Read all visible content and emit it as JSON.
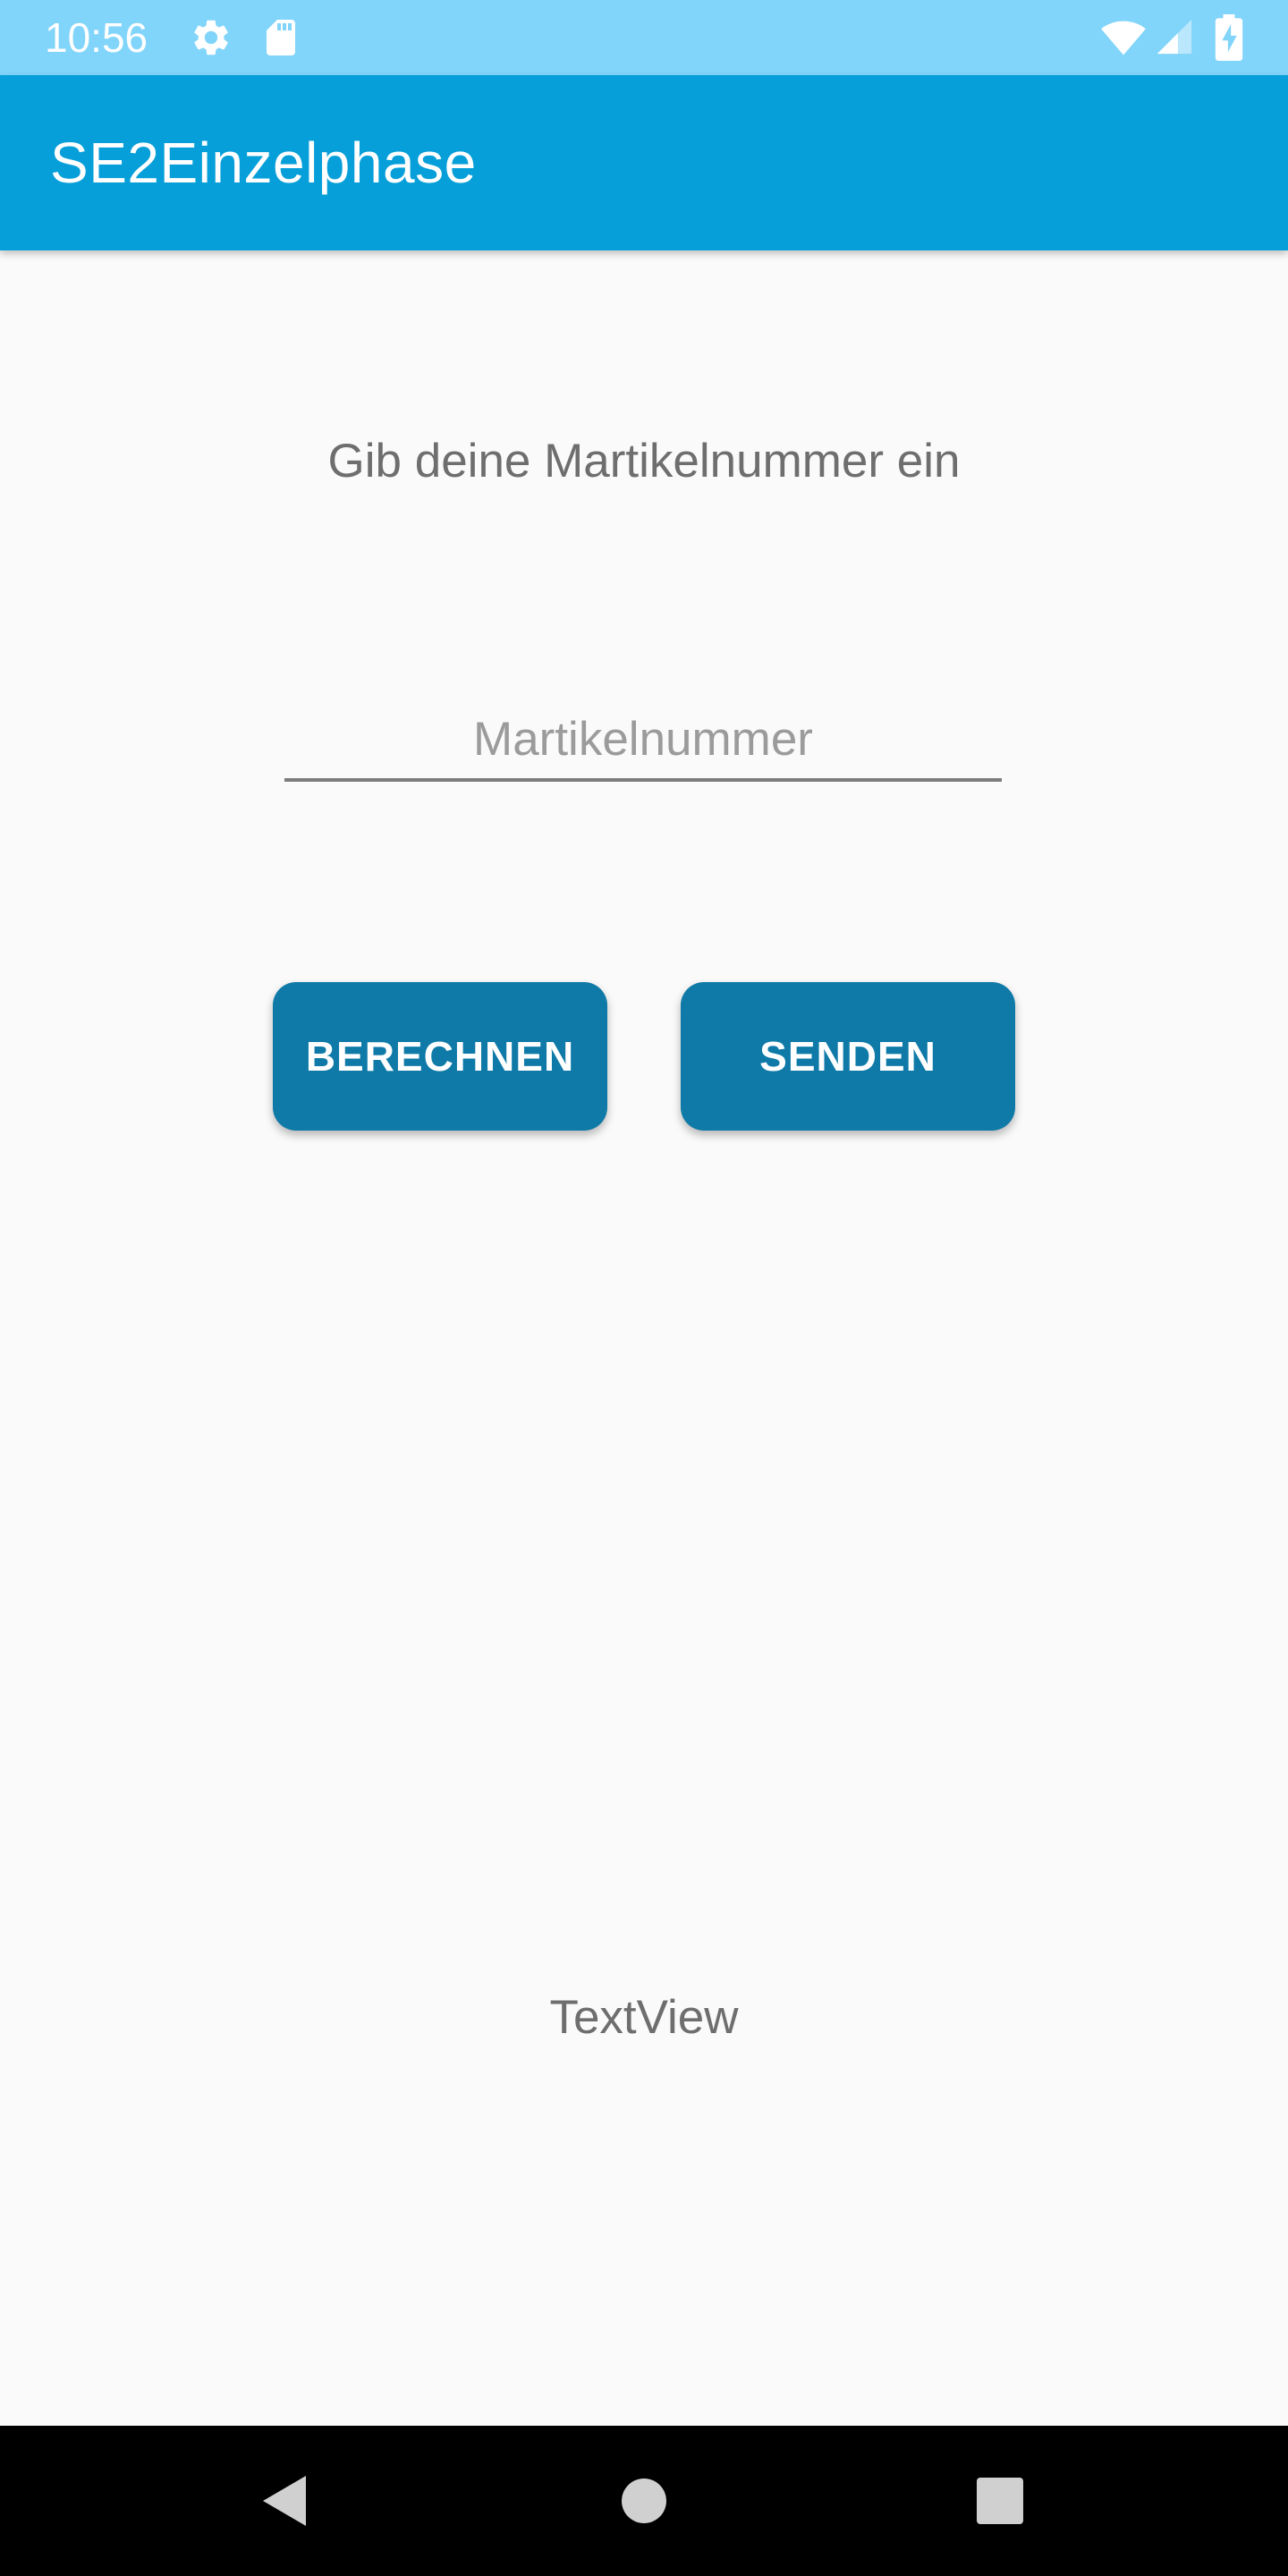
{
  "status_bar": {
    "time": "10:56",
    "icons": [
      "settings-icon",
      "sd-card-icon",
      "wifi-icon",
      "signal-icon",
      "battery-charging-icon"
    ],
    "color": "#81d4fa"
  },
  "app_bar": {
    "title": "SE2Einzelphase",
    "color": "#069fd9"
  },
  "main": {
    "prompt": "Gib deine Martikelnummer ein",
    "input": {
      "value": "",
      "placeholder": "Martikelnummer"
    },
    "buttons": {
      "calculate_label": "BERECHNEN",
      "send_label": "SENDEN",
      "color": "#0f7aa8"
    },
    "result_text": "TextView"
  },
  "nav_bar": {
    "icons": [
      "back-icon",
      "home-icon",
      "recents-icon"
    ]
  }
}
